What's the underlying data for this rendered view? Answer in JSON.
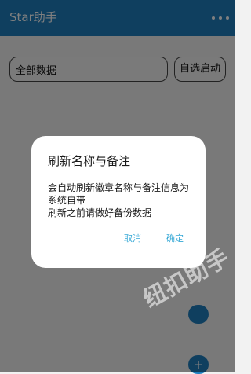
{
  "app": {
    "title": "Star助手",
    "menu_icon": "more-vert-icon"
  },
  "filters": {
    "scope_selected": "全部数据",
    "autostart_label": "自选启动"
  },
  "dialog": {
    "title": "刷新名称与备注",
    "message": "会自动刷新徽章名称与备注信息为系统自带\n刷新之前请做好备份数据",
    "cancel_label": "取消",
    "confirm_label": "确定"
  },
  "fab": {
    "lower_label": "+"
  },
  "watermark": {
    "text": "纽扣助手"
  },
  "colors": {
    "primary": "#1f7fbf",
    "dialog_button": "#35a8d6"
  }
}
